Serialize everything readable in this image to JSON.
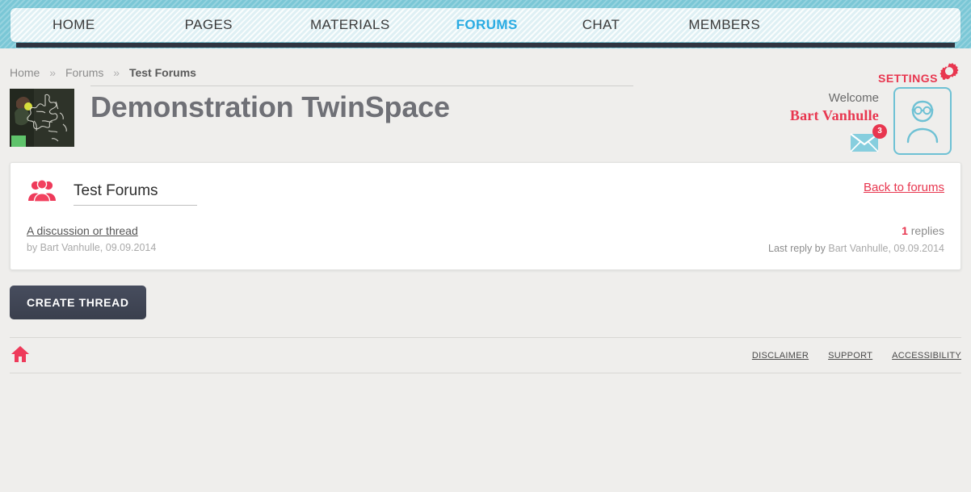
{
  "nav": {
    "items": [
      {
        "label": "HOME",
        "active": false
      },
      {
        "label": "PAGES",
        "active": false
      },
      {
        "label": "MATERIALS",
        "active": false
      },
      {
        "label": "FORUMS",
        "active": true
      },
      {
        "label": "CHAT",
        "active": false
      },
      {
        "label": "MEMBERS",
        "active": false
      }
    ]
  },
  "breadcrumb": {
    "home": "Home",
    "sep": "»",
    "forums": "Forums",
    "current": "Test Forums"
  },
  "settings": {
    "label": "SETTINGS",
    "icon": "gear-icon"
  },
  "header": {
    "title": "Demonstration TwinSpace",
    "thumb_alt": "chalkboard map of Europe"
  },
  "user": {
    "welcome": "Welcome",
    "name": "Bart Vanhulle",
    "messages_badge": "3",
    "mail_icon": "envelope-icon",
    "avatar_icon": "user-avatar-icon"
  },
  "forum": {
    "icon": "group-people-icon",
    "title": "Test Forums",
    "back_link": "Back to forums",
    "threads": [
      {
        "title": "A discussion or thread",
        "meta": "by Bart Vanhulle, 09.09.2014",
        "replies_count": "1",
        "replies_label": "replies",
        "last_reply_prefix": "Last reply by ",
        "last_reply_value": "Bart Vanhulle, 09.09.2014"
      }
    ],
    "create_button": "CREATE THREAD"
  },
  "footer": {
    "home_icon": "home-icon",
    "links": [
      {
        "label": "DISCLAIMER"
      },
      {
        "label": "SUPPORT"
      },
      {
        "label": "ACCESSIBILITY"
      }
    ]
  },
  "colors": {
    "teal": "#7ac7d6",
    "nav_light": "#dff0f4",
    "accent_red": "#e8364f",
    "active_blue": "#29abe2",
    "dark_bar": "#2f3440",
    "button_dark": "#474d5e",
    "page_bg": "#efeeec"
  }
}
